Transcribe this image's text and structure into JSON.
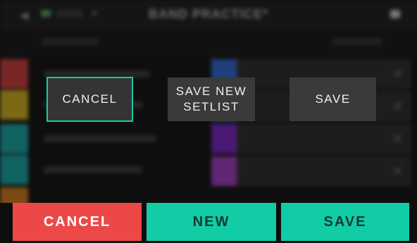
{
  "header": {
    "title": "BAND PRACTICE*"
  },
  "dialog": {
    "cancel_label": "CANCEL",
    "save_new_setlist_label": "SAVE NEW\nSETLIST",
    "save_label": "SAVE"
  },
  "bottom_bar": {
    "cancel_label": "CANCEL",
    "new_label": "NEW",
    "save_label": "SAVE"
  },
  "colors": {
    "accent": "#12cca6",
    "danger": "#ec4848",
    "swatches_left": [
      "#d23b3b",
      "#d6b51c",
      "#17a8a8",
      "#17a8a8",
      "#d97a1e"
    ],
    "swatches_right": [
      "#2f6ad8",
      "#2f6ad8",
      "#7a22c8",
      "#a63bc6"
    ]
  }
}
